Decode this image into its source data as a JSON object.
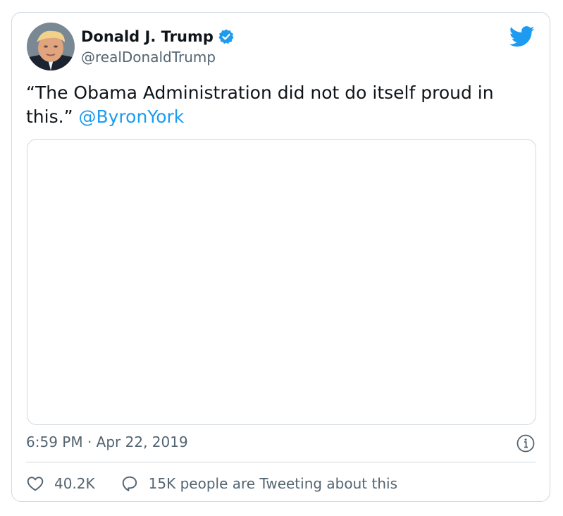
{
  "author": {
    "name": "Donald J. Trump",
    "handle": "@realDonaldTrump",
    "verified": true
  },
  "tweet": {
    "text_before_mention": "“The Obama Administration did not do itself proud in this.” ",
    "mention": "@ByronYork"
  },
  "meta": {
    "time": "6:59 PM",
    "separator": " · ",
    "date": "Apr 22, 2019"
  },
  "actions": {
    "likes": "40.2K",
    "conversation": "15K people are Tweeting about this"
  },
  "icons": {
    "brand": "twitter-bird-icon",
    "verified": "verified-badge-icon",
    "info": "info-icon",
    "like": "heart-icon",
    "reply": "speech-bubble-icon"
  },
  "colors": {
    "accent": "#1d9bf0",
    "text": "#0f1419",
    "secondary": "#536471",
    "border": "#cfd9de"
  }
}
